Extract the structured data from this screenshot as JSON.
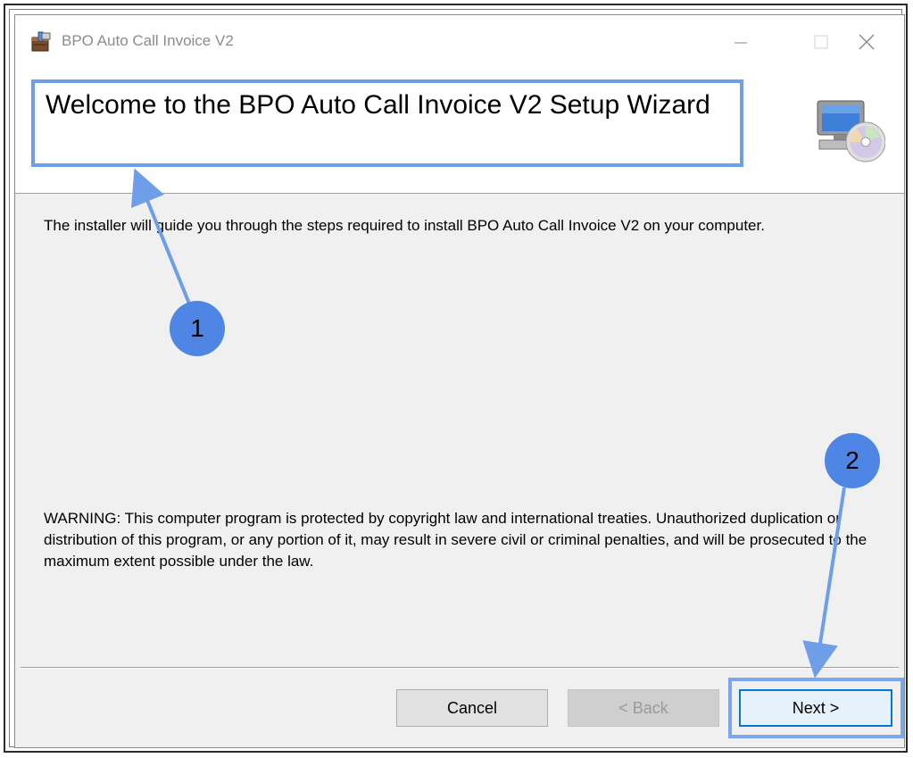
{
  "window": {
    "title": "BPO Auto Call Invoice V2"
  },
  "header": {
    "welcome_title": "Welcome to the BPO Auto Call Invoice V2 Setup Wizard"
  },
  "body": {
    "intro": "The installer will guide you through the steps required to install BPO Auto Call Invoice V2 on your computer.",
    "warning": "WARNING: This computer program is protected by copyright law and international treaties. Unauthorized duplication or distribution of this program, or any portion of it, may result in severe civil or criminal penalties, and will be prosecuted to the maximum extent possible under the law."
  },
  "buttons": {
    "cancel": "Cancel",
    "back": "< Back",
    "next": "Next >"
  },
  "annotations": {
    "badge_1": "1",
    "badge_2": "2"
  },
  "colors": {
    "annotation_blue": "#4f86e6",
    "highlight_border": "#6f9ee8",
    "focus_blue": "#0078d7"
  },
  "icons": {
    "app": "installer-package-icon",
    "setup": "computer-cd-icon",
    "minimize": "minimize-icon",
    "maximize": "maximize-icon",
    "close": "close-icon"
  }
}
